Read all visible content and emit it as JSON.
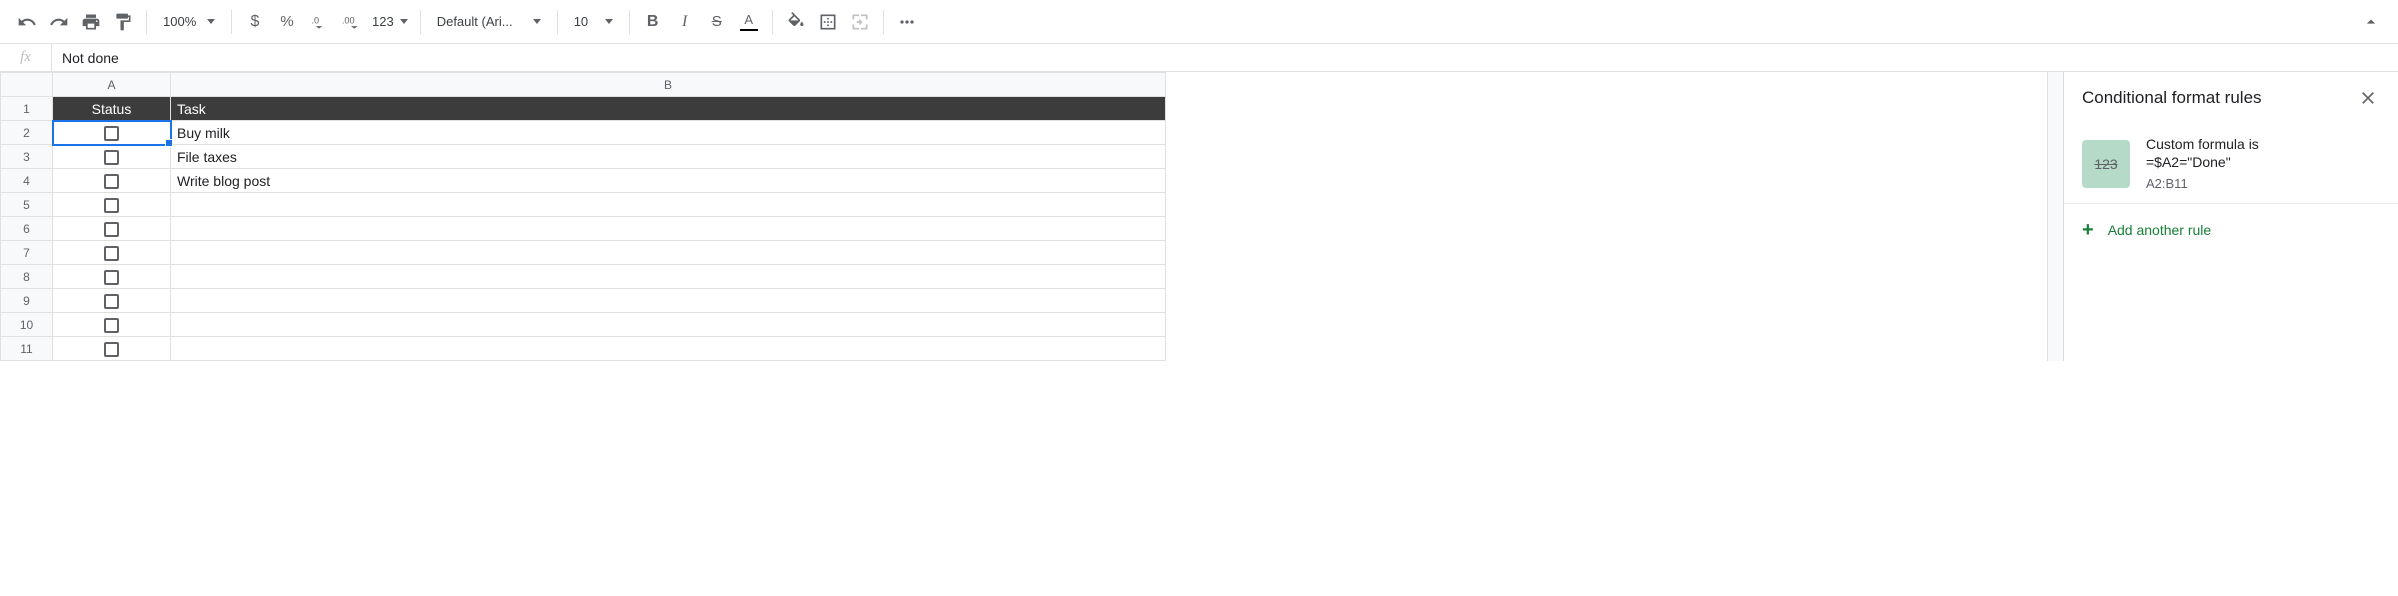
{
  "toolbar": {
    "zoom": "100%",
    "font": "Default (Ari...",
    "font_size": "10",
    "num_format": "123"
  },
  "formula_bar": {
    "value": "Not done"
  },
  "grid": {
    "columns": [
      "A",
      "B"
    ],
    "header_row": {
      "status": "Status",
      "task": "Task"
    },
    "rows": [
      {
        "num": 2,
        "checked": false,
        "task": "Buy milk",
        "selected": true
      },
      {
        "num": 3,
        "checked": false,
        "task": "File taxes",
        "selected": false
      },
      {
        "num": 4,
        "checked": false,
        "task": "Write blog post",
        "selected": false
      },
      {
        "num": 5,
        "checked": false,
        "task": "",
        "selected": false
      },
      {
        "num": 6,
        "checked": false,
        "task": "",
        "selected": false
      },
      {
        "num": 7,
        "checked": false,
        "task": "",
        "selected": false
      },
      {
        "num": 8,
        "checked": false,
        "task": "",
        "selected": false
      },
      {
        "num": 9,
        "checked": false,
        "task": "",
        "selected": false
      },
      {
        "num": 10,
        "checked": false,
        "task": "",
        "selected": false
      },
      {
        "num": 11,
        "checked": false,
        "task": "",
        "selected": false
      }
    ]
  },
  "sidebar": {
    "title": "Conditional format rules",
    "rule": {
      "swatch_text": "123",
      "line1": "Custom formula is",
      "line2": "=$A2=\"Done\"",
      "range": "A2:B11"
    },
    "add_label": "Add another rule"
  }
}
